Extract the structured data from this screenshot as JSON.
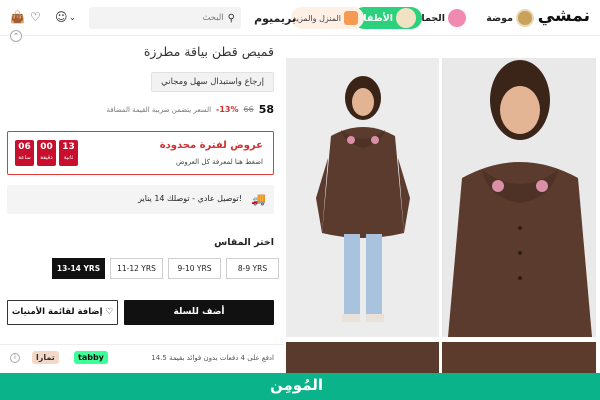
{
  "header": {
    "logo": "نمشي",
    "categories": {
      "fashion": "موضة",
      "beauty": "الجمال",
      "kids": "الأطفال",
      "home": "المنزل والمزيد",
      "premium": "بريميوم"
    },
    "search_placeholder": "البحث"
  },
  "product": {
    "title": "قميص قطن بياقة مطرزة",
    "chip": "إرجاع واستبدال سهل ومجاني",
    "price_now": "58",
    "price_old": "66",
    "discount": "-13%",
    "vat_note": "السعر يتضمن ضريبة القيمة المضافة"
  },
  "offer": {
    "title": "عروض لفترة محدودة",
    "subtitle": "اضغط هنا لمعرفة كل العروض",
    "countdown": [
      {
        "value": "13",
        "unit": "ثانية"
      },
      {
        "value": "00",
        "unit": "دقيقة"
      },
      {
        "value": "06",
        "unit": "ساعة"
      }
    ]
  },
  "delivery": {
    "text": "توصيل عادي - توصلك 14 يناير!"
  },
  "sizes": {
    "label": "اختر المقاس",
    "options": [
      "13-14 YRS",
      "11-12 YRS",
      "9-10 YRS",
      "8-9 YRS"
    ],
    "selected": "13-14 YRS"
  },
  "actions": {
    "add_to_cart": "أضف للسلة",
    "add_to_wishlist": "إضافة لقائمة الأمنيات"
  },
  "bnpl": {
    "text": "ادفع على 4 دفعات بدون فوائد بقيمة 14.5",
    "tabby": "tabby",
    "tamara": "تمارا"
  },
  "banner": {
    "text": "المُومِن"
  },
  "colors": {
    "accent_red": "#d32f2f",
    "banner_green": "#0ab38a",
    "kids_green": "#2bd17c"
  }
}
